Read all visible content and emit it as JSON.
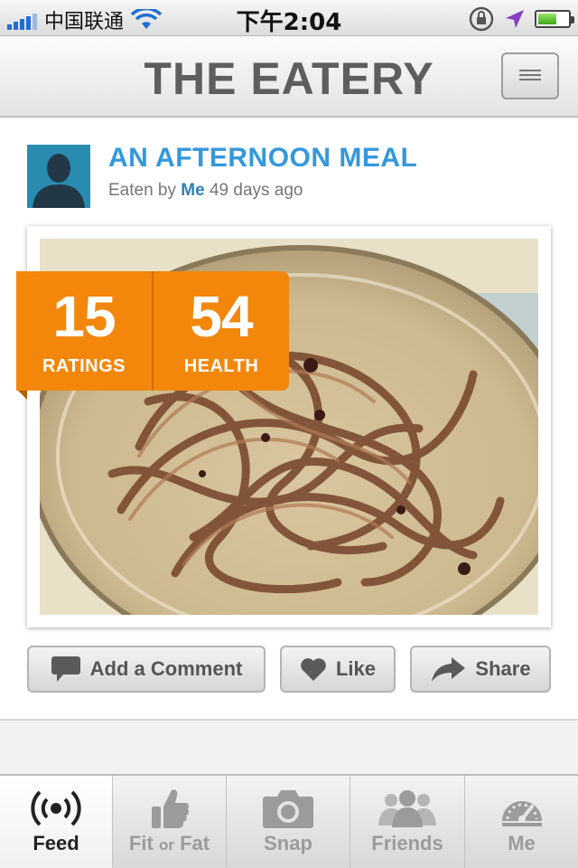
{
  "status_bar": {
    "carrier": "中国联通",
    "time": "下午2:04"
  },
  "header": {
    "title": "THE EATERY",
    "menu_icon": "hamburger-icon"
  },
  "post": {
    "title": "AN AFTERNOON MEAL",
    "meta_prefix": "Eaten by",
    "author": "Me",
    "meta_suffix": "49 days ago",
    "stats": {
      "ratings_value": "15",
      "ratings_label": "RATINGS",
      "health_value": "54",
      "health_label": "HEALTH"
    }
  },
  "actions": {
    "comment": "Add a Comment",
    "like": "Like",
    "share": "Share"
  },
  "tabs": {
    "feed": "Feed",
    "fit": "Fit",
    "or": "or",
    "fat": "Fat",
    "snap": "Snap",
    "friends": "Friends",
    "me": "Me"
  },
  "colors": {
    "accent_blue": "#3498db",
    "badge_orange": "#f2870c"
  }
}
